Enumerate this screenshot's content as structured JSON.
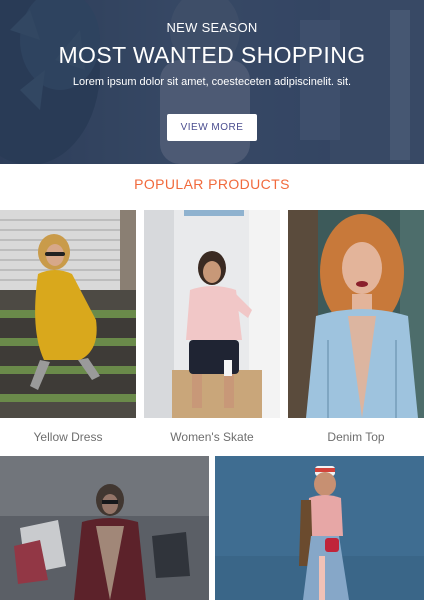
{
  "hero": {
    "eyebrow": "NEW SEASON",
    "headline": "MOST WANTED SHOPPING",
    "subtitle": "Lorem ipsum dolor sit amet, coesteceten adipiscinelit. sit.",
    "button_label": "VIEW MORE"
  },
  "popular": {
    "title": "POPULAR PRODUCTS",
    "products": [
      {
        "name": "Yellow Dress"
      },
      {
        "name": "Women's Skate"
      },
      {
        "name": "Denim Top"
      }
    ]
  },
  "colors": {
    "accent": "#f16a3c",
    "button_text": "#4a4d8f",
    "hero_overlay": "#2f4566"
  }
}
